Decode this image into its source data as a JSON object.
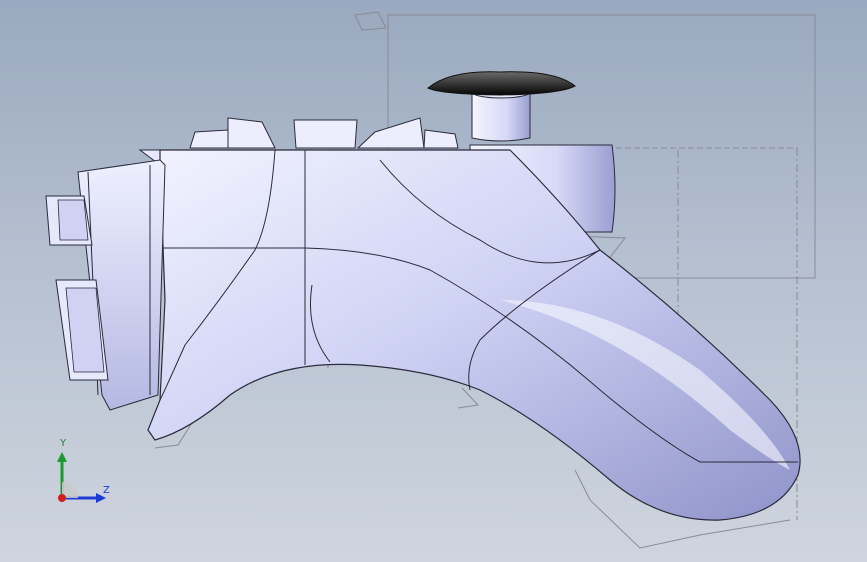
{
  "viewport": {
    "background_top": "#9aa9bf",
    "background_bottom": "#cfd5de",
    "model": {
      "name": "gamepad-grip",
      "body_color": "#d9dcf7",
      "shade_color": "#9ea3d6",
      "edge_color": "#2a2a3a",
      "thumbstick_cap_color": "#111111",
      "sketch_line_color": "#8a8a95"
    }
  },
  "triad": {
    "y_label": "Y",
    "z_label": "Z",
    "y_color": "#1d9a2f",
    "z_color": "#1e3bd6",
    "x_color": "#d41b1b"
  }
}
